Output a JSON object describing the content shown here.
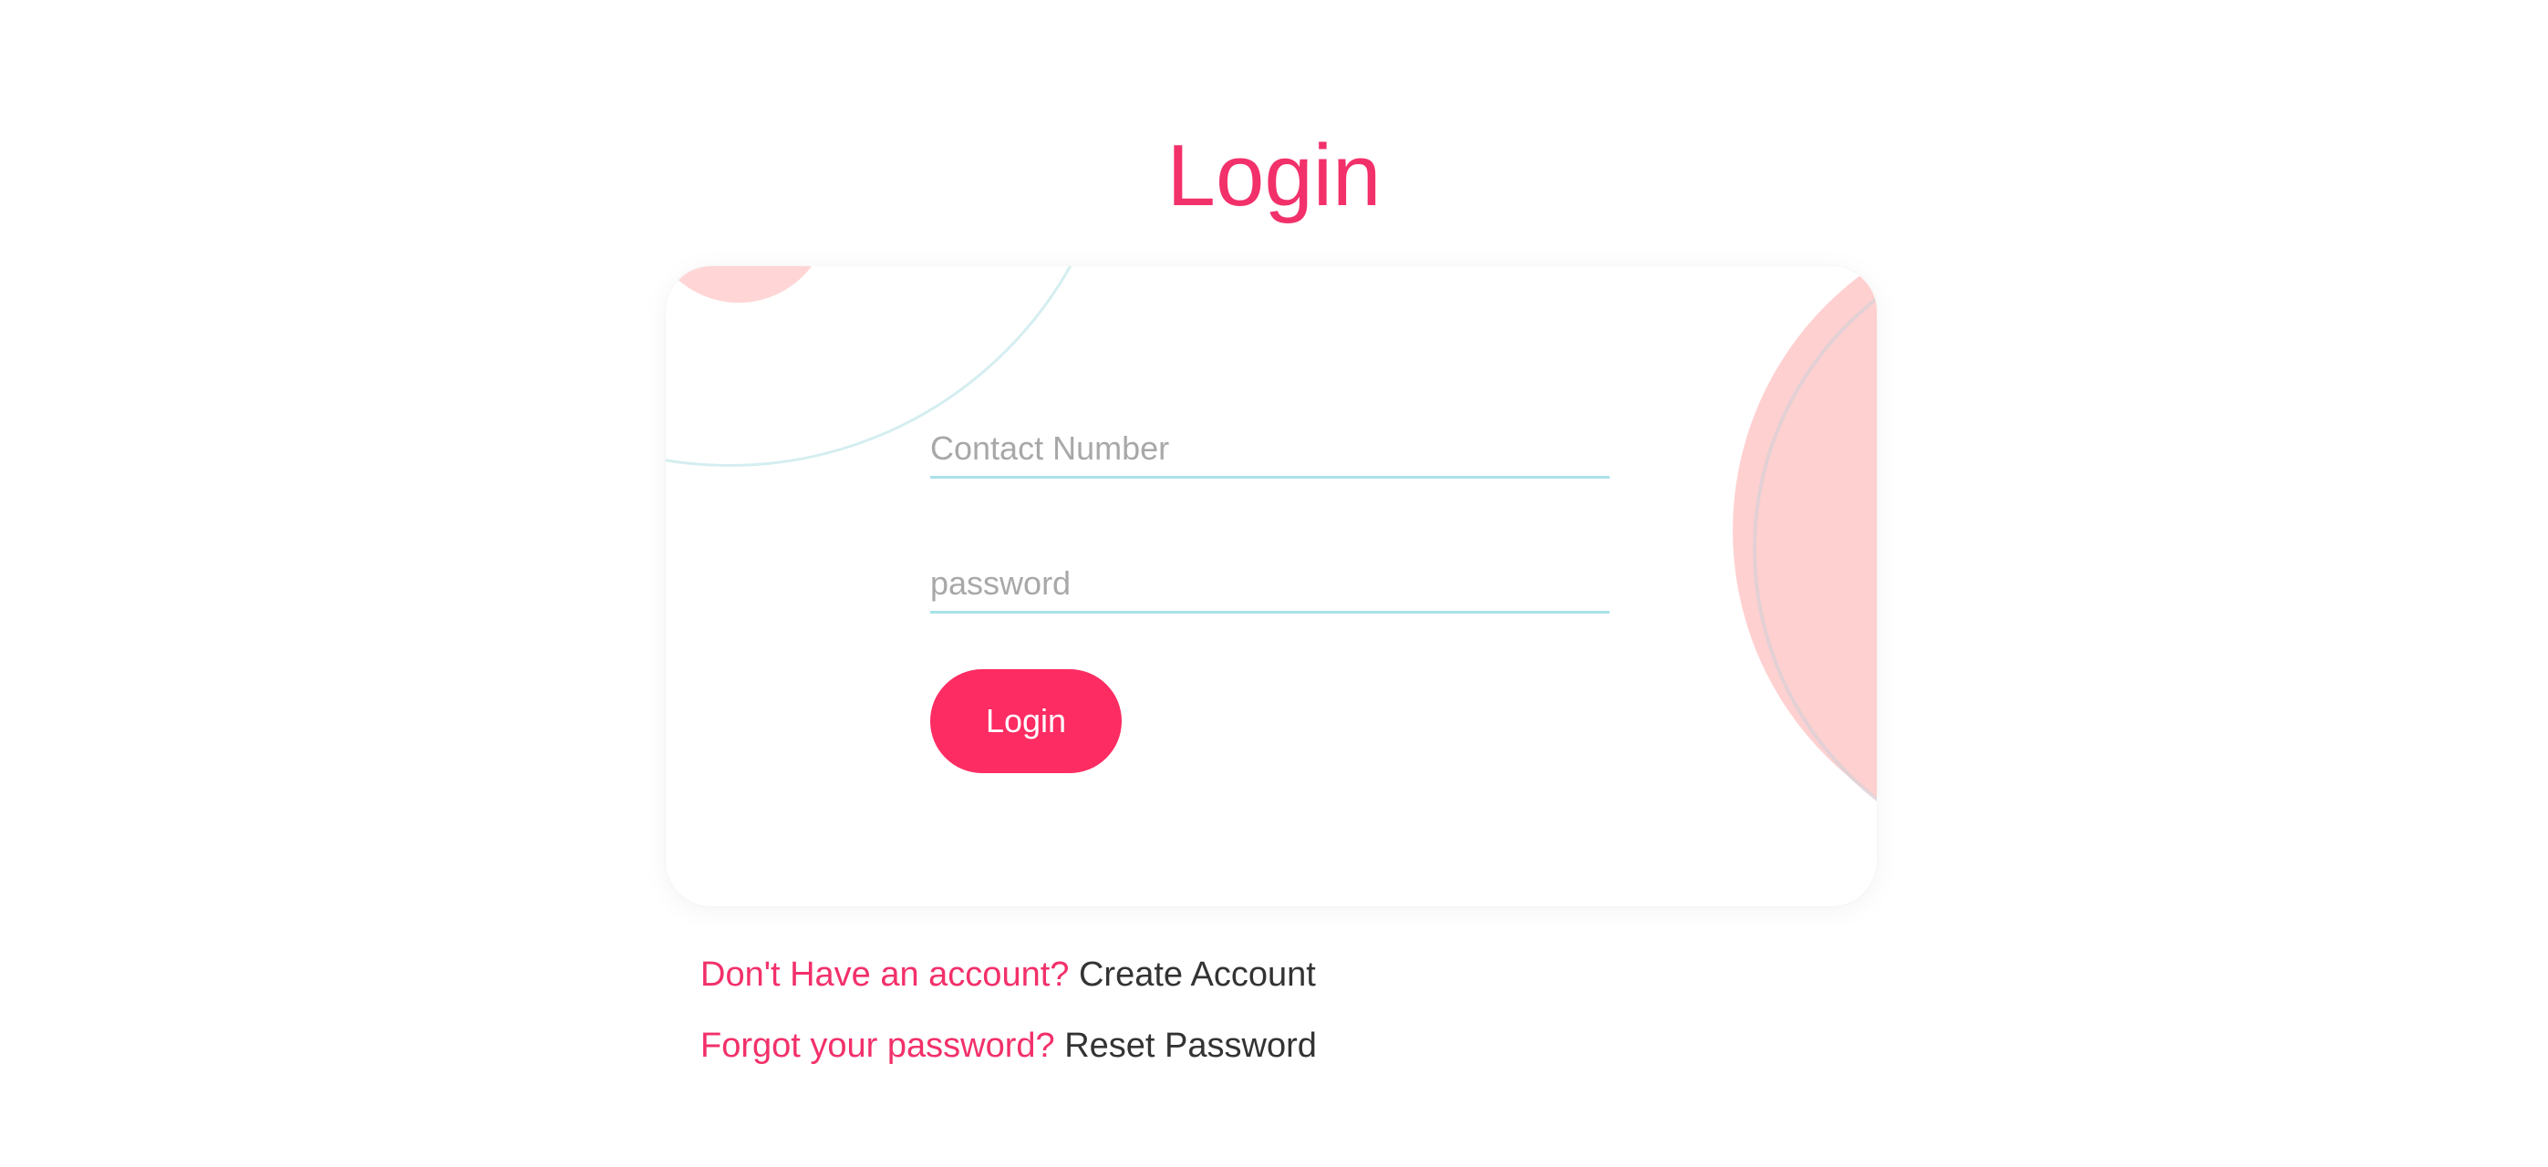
{
  "page": {
    "title": "Login"
  },
  "form": {
    "contact": {
      "placeholder": "Contact Number",
      "value": ""
    },
    "password": {
      "placeholder": "password",
      "value": ""
    },
    "submit_label": "Login"
  },
  "links": {
    "signup": {
      "prompt": "Don't Have an account?",
      "action": "Create Account"
    },
    "reset": {
      "prompt": "Forgot your password?",
      "action": "Reset Password"
    }
  },
  "colors": {
    "accent": "#f2306a",
    "button": "#fd2c63",
    "input_underline": "#a9e2ea",
    "decor_pink": "#ffd0d0",
    "link_text": "#333333"
  }
}
